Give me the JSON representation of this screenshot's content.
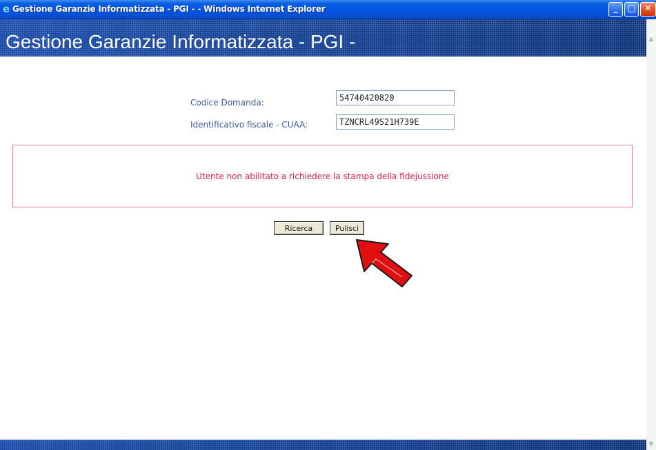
{
  "window": {
    "title": "Gestione Garanzie Informatizzata - PGI - - Windows Internet Explorer",
    "icon": "ie-icon",
    "minimize_glyph": "_",
    "maximize_glyph": "□",
    "close_glyph": "✕"
  },
  "header": {
    "title": "Gestione Garanzie Informatizzata - PGI -"
  },
  "form": {
    "codice_label": "Codice Domanda:",
    "codice_value": "54740420820",
    "cuaa_label": "Identificativo fiscale - CUAA:",
    "cuaa_value": "TZNCRL49S21H739E"
  },
  "message": {
    "error_text": "Utente non abilitato a richiedere la stampa della fidejussione"
  },
  "buttons": {
    "ricerca_label": "Ricerca",
    "pulisci_label": "Pulisci"
  },
  "colors": {
    "header_blue": "#1c4aa3",
    "error_red": "#e8194b",
    "label_blue": "#3a5aa8",
    "arrow_red": "#e01010"
  }
}
